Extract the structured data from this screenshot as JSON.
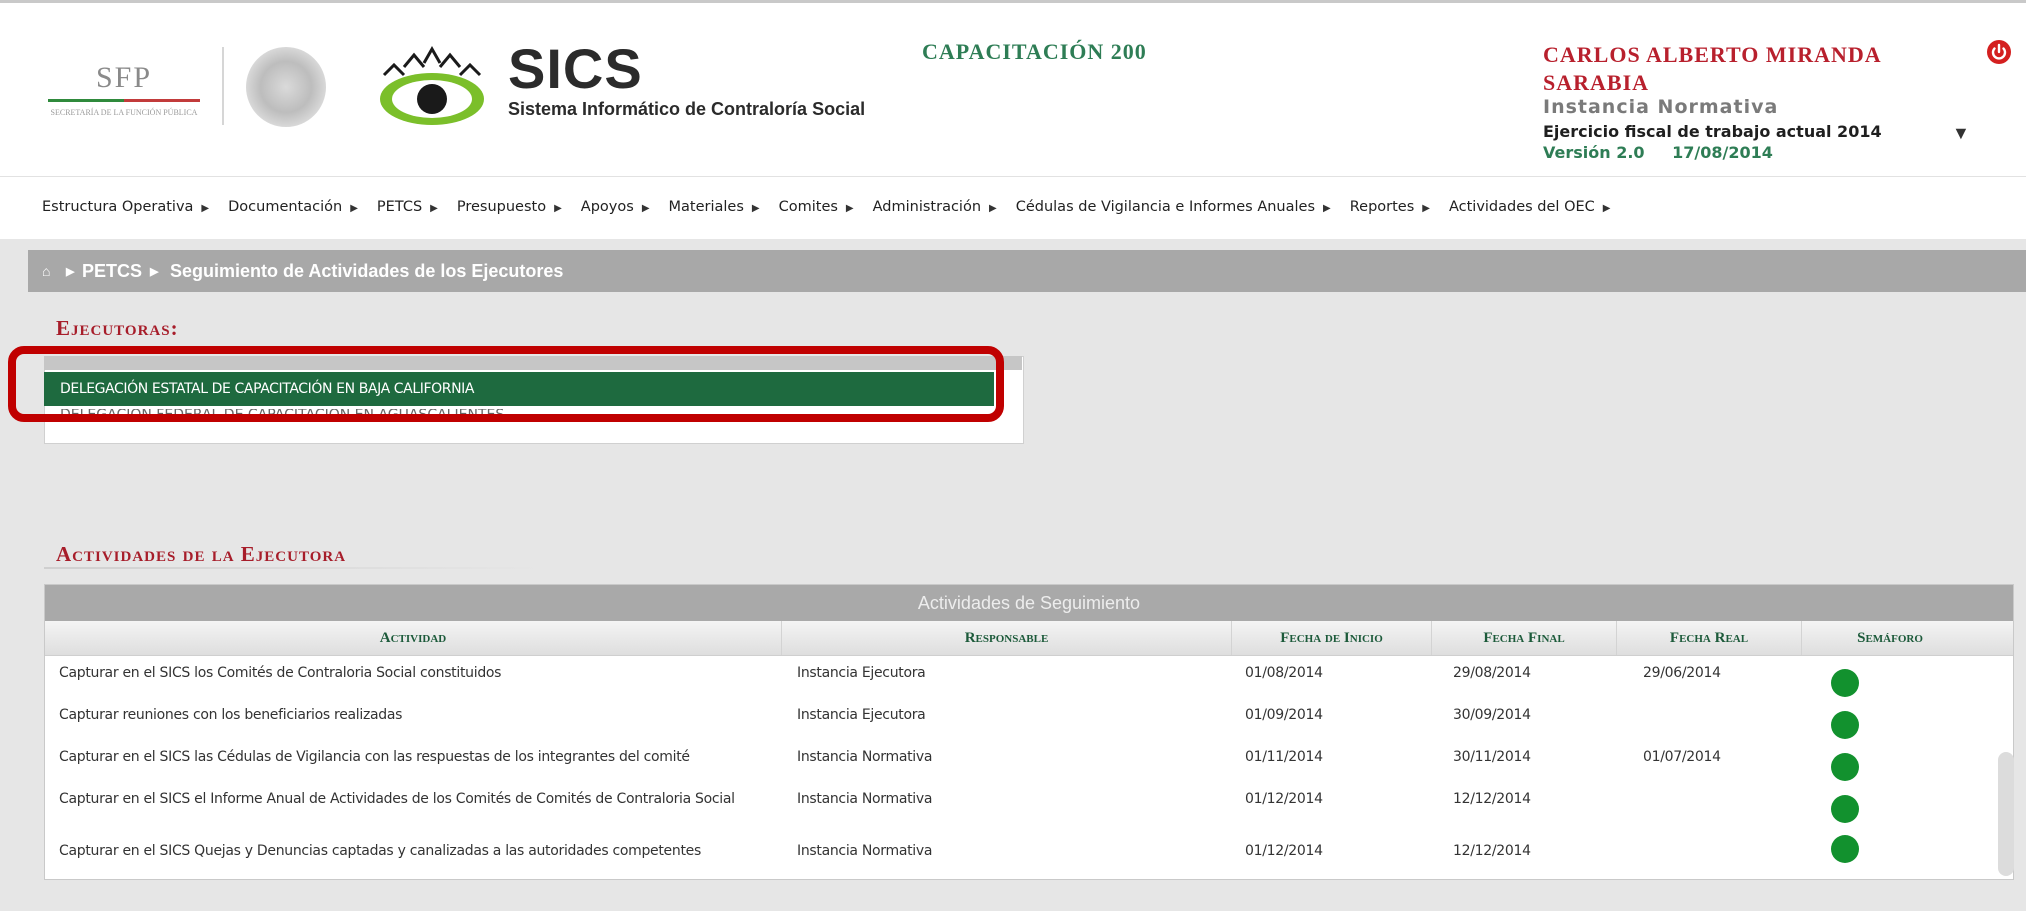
{
  "header": {
    "sfp_logo_text": "SFP",
    "sfp_logo_subtitle": "SECRETARÍA DE LA FUNCIÓN PÚBLICA",
    "app_name": "SICS",
    "app_subtitle": "Sistema Informático de Contraloría Social",
    "course_title": "CAPACITACIÓN 200",
    "user_name": "CARLOS ALBERTO MIRANDA SARABIA",
    "user_role": "Instancia Normativa",
    "fiscal_year": "Ejercicio fiscal de trabajo actual 2014",
    "version": "Versión 2.0",
    "version_date": "17/08/2014",
    "icons": {
      "power": "power-icon",
      "dropdown": "dropdown-arrow-icon"
    },
    "colors": {
      "user": "#b8202d",
      "accent_green": "#2e7d55"
    }
  },
  "menu": [
    "Estructura Operativa",
    "Documentación",
    "PETCS",
    "Presupuesto",
    "Apoyos",
    "Materiales",
    "Comites",
    "Administración",
    "Cédulas de Vigilancia e Informes Anuales",
    "Reportes",
    "Actividades del OEC"
  ],
  "breadcrumb": {
    "home_icon": "home-icon",
    "section": "PETCS",
    "page": "Seguimiento de Actividades de los Ejecutores"
  },
  "ejecutoras": {
    "title": "Ejecutoras:",
    "selected": "DELEGACIÓN ESTATAL DE CAPACITACIÓN EN BAJA CALIFORNIA",
    "other": "DELEGACIÓN FEDERAL DE CAPACITACIÓN EN AGUASCALIENTES"
  },
  "actividades": {
    "title": "Actividades de la Ejecutora",
    "caption": "Actividades de Seguimiento",
    "columns": [
      "Actividad",
      "Responsable",
      "Fecha de Inicio",
      "Fecha Final",
      "Fecha Real",
      "Semáforo"
    ],
    "rows": [
      {
        "actividad": "Capturar en el SICS los Comités de Contraloria Social constituidos",
        "responsable": "Instancia Ejecutora",
        "inicio": "01/08/2014",
        "final": "29/08/2014",
        "real": "29/06/2014",
        "semaforo": "green"
      },
      {
        "actividad": "Capturar reuniones con los beneficiarios realizadas",
        "responsable": "Instancia Ejecutora",
        "inicio": "01/09/2014",
        "final": "30/09/2014",
        "real": "",
        "semaforo": "green"
      },
      {
        "actividad": "Capturar en el SICS las Cédulas de Vigilancia con las respuestas de los integrantes del comité",
        "responsable": "Instancia Normativa",
        "inicio": "01/11/2014",
        "final": "30/11/2014",
        "real": "01/07/2014",
        "semaforo": "green"
      },
      {
        "actividad": "Capturar en el SICS el Informe Anual de Actividades de los Comités de Comités de Contraloria Social",
        "responsable": "Instancia Normativa",
        "inicio": "01/12/2014",
        "final": "12/12/2014",
        "real": "",
        "semaforo": "green"
      },
      {
        "actividad": "Capturar en el SICS Quejas y Denuncias captadas y canalizadas a las autoridades competentes",
        "responsable": "Instancia Normativa",
        "inicio": "01/12/2014",
        "final": "12/12/2014",
        "real": "",
        "semaforo": "green"
      }
    ],
    "semaforo_color": "#12912e"
  }
}
